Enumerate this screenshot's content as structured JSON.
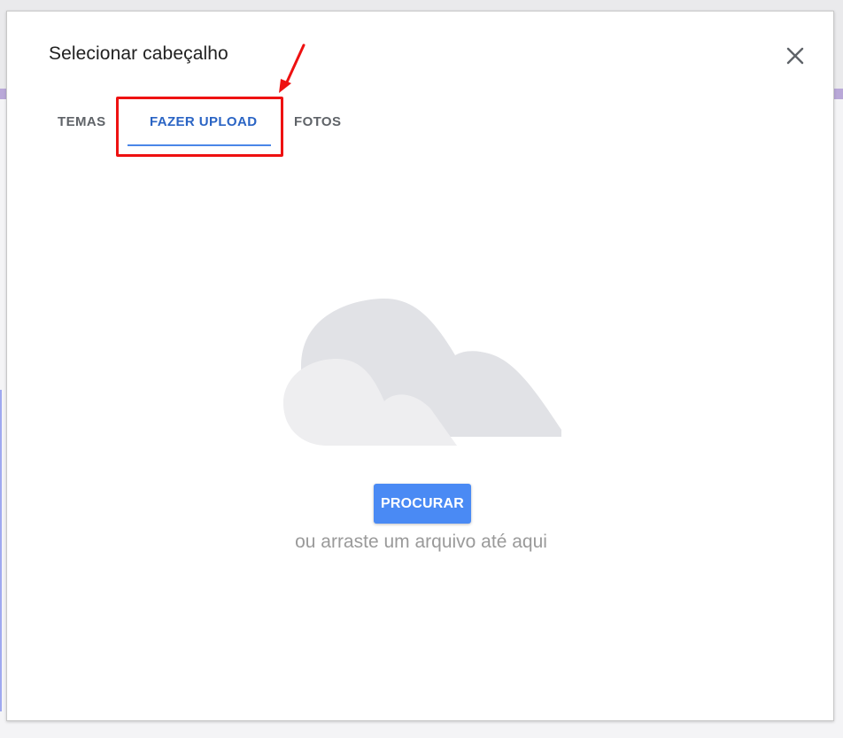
{
  "dialog": {
    "title": "Selecionar cabeçalho",
    "close_icon": "close-icon"
  },
  "tabs": [
    {
      "label": "TEMAS",
      "active": false
    },
    {
      "label": "FAZER UPLOAD",
      "active": true
    },
    {
      "label": "FOTOS",
      "active": false
    }
  ],
  "upload": {
    "illustration": "cloud-illustration",
    "browse_label": "PROCURAR",
    "drag_hint": "ou arraste um arquivo até aqui"
  },
  "annotation": {
    "highlight": "red-highlight-box",
    "arrow": "red-arrow"
  },
  "colors": {
    "accent": "#4a8af4",
    "active_tab": "#2a64c4",
    "highlight": "#ee1111"
  }
}
